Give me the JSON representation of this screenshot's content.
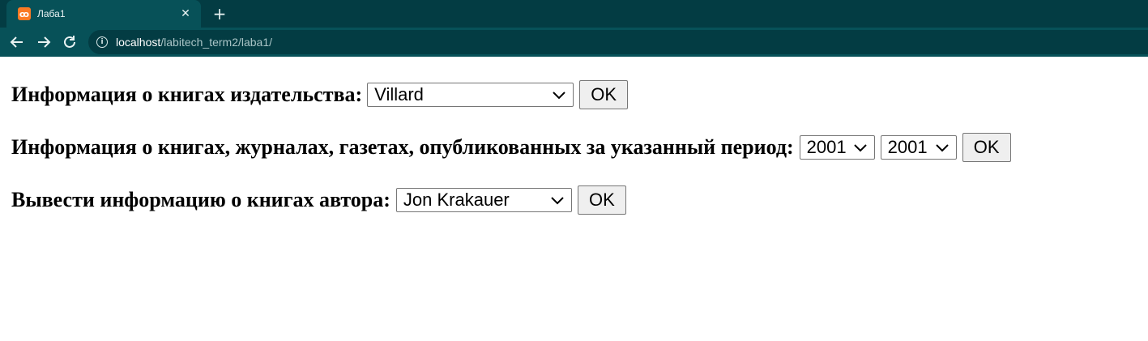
{
  "browser": {
    "tab_title": "Лаба1",
    "favicon_glyph": "ꝏ",
    "close_glyph": "✕",
    "new_tab_glyph": "+",
    "url_host": "localhost",
    "url_path": "/labitech_term2/laba1/",
    "icons": {
      "back": "arrow-left-icon",
      "forward": "arrow-right-icon",
      "reload": "reload-icon",
      "info": "info-icon"
    }
  },
  "forms": {
    "publisher": {
      "label": "Информация о книгах издательства:",
      "selected": "Villard",
      "button": "OK"
    },
    "period": {
      "label": "Информация о книгах, журналах, газетах, опубликованных за указанный период:",
      "from_selected": "2001",
      "to_selected": "2001",
      "button": "OK"
    },
    "author": {
      "label": "Вывести информацию о книгах автора:",
      "selected": "Jon Krakauer",
      "button": "OK"
    }
  },
  "colors": {
    "chrome_dark": "#033c43",
    "chrome_light": "#075158",
    "favicon": "#fb7a24"
  }
}
